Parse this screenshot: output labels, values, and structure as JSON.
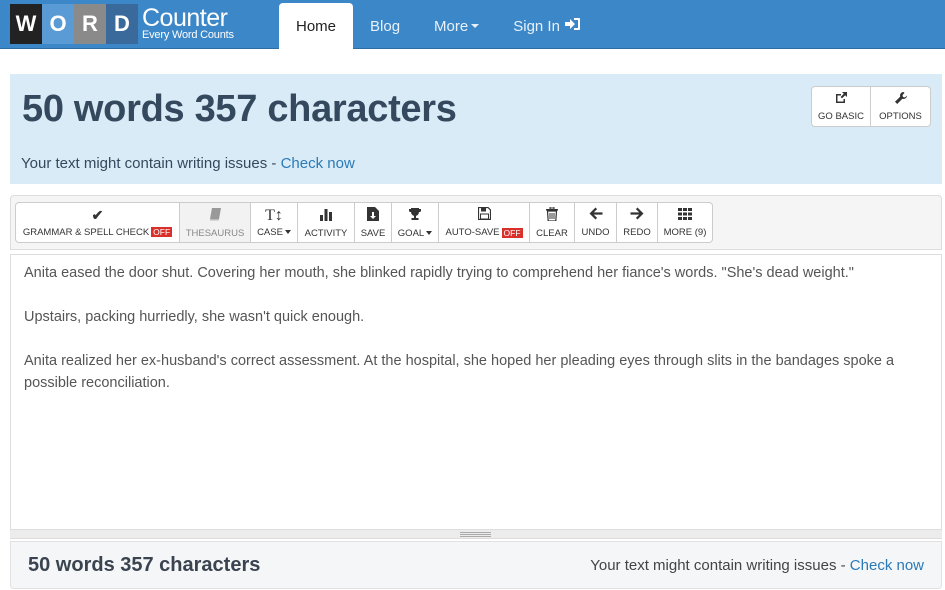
{
  "brand": {
    "letters": [
      "W",
      "O",
      "R",
      "D"
    ],
    "title": "Counter",
    "tagline": "Every Word Counts"
  },
  "nav": {
    "items": [
      {
        "label": "Home",
        "active": true
      },
      {
        "label": "Blog"
      },
      {
        "label": "More"
      },
      {
        "label": "Sign In"
      }
    ]
  },
  "stats": {
    "headline": "50 words 357 characters",
    "words": 50,
    "characters": 357,
    "issues_text": "Your text might contain writing issues - ",
    "check_link": "Check now"
  },
  "top_buttons": {
    "go_basic": {
      "label": "GO BASIC",
      "icon": "external-link-icon"
    },
    "options": {
      "label": "OPTIONS",
      "icon": "wrench-icon"
    }
  },
  "toolbar": {
    "grammar": {
      "label": "GRAMMAR & SPELL CHECK",
      "badge": "OFF",
      "icon": "check-icon"
    },
    "thesaurus": {
      "label": "THESAURUS",
      "icon": "book-icon"
    },
    "case": {
      "label": "CASE",
      "icon": "text-height-icon",
      "icon_glyph": "T↕"
    },
    "activity": {
      "label": "ACTIVITY",
      "icon": "bar-chart-icon"
    },
    "save": {
      "label": "SAVE",
      "icon": "download-file-icon"
    },
    "goal": {
      "label": "GOAL",
      "icon": "trophy-icon"
    },
    "autosave": {
      "label": "AUTO-SAVE",
      "badge": "OFF",
      "icon": "floppy-icon"
    },
    "clear": {
      "label": "CLEAR",
      "icon": "trash-icon"
    },
    "undo": {
      "label": "UNDO",
      "icon": "arrow-left-icon"
    },
    "redo": {
      "label": "REDO",
      "icon": "arrow-right-icon"
    },
    "more": {
      "label": "MORE (9)",
      "icon": "grid-icon"
    }
  },
  "editor": {
    "paragraphs": [
      "Anita eased the door shut. Covering her mouth, she blinked rapidly trying to comprehend her fiance's words. \"She's dead weight.\"",
      "Upstairs, packing hurriedly, she wasn't quick enough.",
      "Anita realized her ex-husband's correct assessment. At the hospital, she hoped her pleading eyes through slits in the bandages spoke a possible reconciliation."
    ]
  },
  "footer": {
    "headline": "50 words 357 characters",
    "issues_text": "Your text might contain writing issues - ",
    "check_link": "Check now"
  },
  "colors": {
    "navbar": "#3c87c8",
    "stats_panel": "#d9ebf6",
    "link": "#2a7ab8",
    "off_badge": "#d9302c"
  }
}
